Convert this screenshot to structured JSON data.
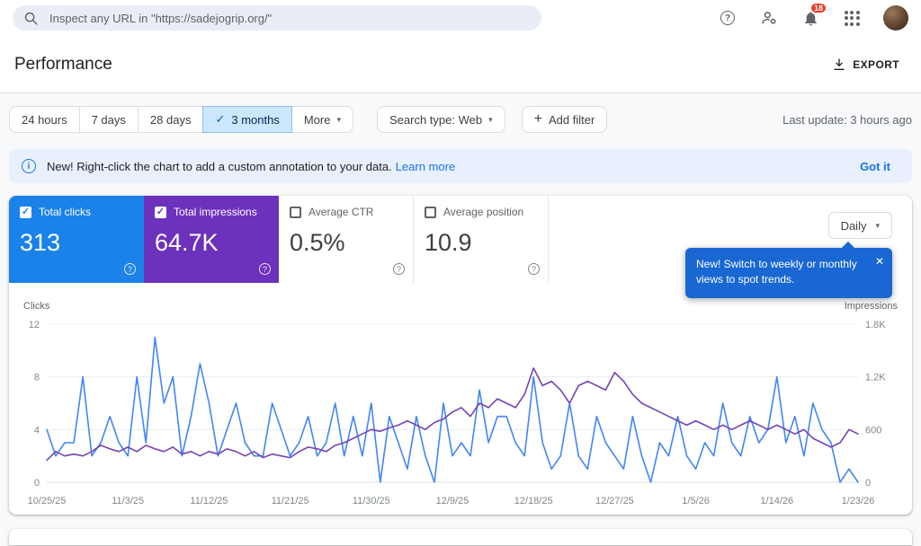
{
  "icons": {
    "check": "✓",
    "caret": "▾",
    "plus": "+",
    "close": "✕",
    "question": "?",
    "info": "i"
  },
  "topbar": {
    "search_placeholder": "Inspect any URL in \"https://sadejogrip.org/\"",
    "notification_count": "18"
  },
  "header": {
    "title": "Performance",
    "export_label": "EXPORT"
  },
  "filters": {
    "date_ranges": [
      {
        "label": "24 hours",
        "selected": false
      },
      {
        "label": "7 days",
        "selected": false
      },
      {
        "label": "28 days",
        "selected": false
      },
      {
        "label": "3 months",
        "selected": true
      },
      {
        "label": "More",
        "selected": false
      }
    ],
    "search_type_label": "Search type: Web",
    "add_filter_label": "Add filter",
    "last_update": "Last update: 3 hours ago"
  },
  "banner": {
    "text": "New! Right-click the chart to add a custom annotation to your data.",
    "link": "Learn more",
    "dismiss": "Got it"
  },
  "metrics": {
    "cards": [
      {
        "label": "Total clicks",
        "value": "313",
        "checked": true,
        "filled": true,
        "color": "#1a82e8"
      },
      {
        "label": "Total impressions",
        "value": "64.7K",
        "checked": true,
        "filled": true,
        "color": "#6d32bc"
      },
      {
        "label": "Average CTR",
        "value": "0.5%",
        "checked": false,
        "filled": false
      },
      {
        "label": "Average position",
        "value": "10.9",
        "checked": false,
        "filled": false
      }
    ],
    "granularity": "Daily"
  },
  "tooltip": {
    "text": "New! Switch to weekly or monthly views to spot trends."
  },
  "chart_data": {
    "type": "line",
    "left_axis": {
      "label": "Clicks",
      "max": 12,
      "ticks": [
        {
          "value": 0,
          "label": "0"
        },
        {
          "value": 4,
          "label": "4"
        },
        {
          "value": 8,
          "label": "8"
        },
        {
          "value": 12,
          "label": "12"
        }
      ]
    },
    "right_axis": {
      "label": "Impressions",
      "max": 1800,
      "ticks": [
        {
          "value": 0,
          "label": "0"
        },
        {
          "value": 600,
          "label": "600"
        },
        {
          "value": 1200,
          "label": "1.2K"
        },
        {
          "value": 1800,
          "label": "1.8K"
        }
      ]
    },
    "x_ticks": [
      {
        "index": 0,
        "label": "10/25/25"
      },
      {
        "index": 9,
        "label": "11/3/25"
      },
      {
        "index": 18,
        "label": "11/12/25"
      },
      {
        "index": 27,
        "label": "11/21/25"
      },
      {
        "index": 36,
        "label": "11/30/25"
      },
      {
        "index": 45,
        "label": "12/9/25"
      },
      {
        "index": 54,
        "label": "12/18/25"
      },
      {
        "index": 63,
        "label": "12/27/25"
      },
      {
        "index": 72,
        "label": "1/5/26"
      },
      {
        "index": 81,
        "label": "1/14/26"
      },
      {
        "index": 90,
        "label": "1/23/26"
      }
    ],
    "series": [
      {
        "name": "Clicks",
        "axis": "left",
        "color": "#4285f4",
        "values": [
          4,
          2,
          3,
          3,
          8,
          2,
          3,
          5,
          3,
          2,
          8,
          3,
          11,
          6,
          8,
          2,
          5,
          9,
          6,
          2,
          4,
          6,
          3,
          2,
          2,
          6,
          4,
          2,
          3,
          5,
          2,
          3,
          6,
          2,
          5,
          2,
          6,
          0,
          5,
          3,
          1,
          5,
          2,
          0,
          6,
          2,
          3,
          2,
          7,
          3,
          5,
          5,
          3,
          2,
          8,
          3,
          1,
          2,
          6,
          2,
          1,
          5,
          3,
          2,
          1,
          5,
          2,
          0,
          3,
          2,
          5,
          2,
          1,
          3,
          2,
          6,
          3,
          2,
          5,
          3,
          4,
          8,
          3,
          5,
          2,
          6,
          4,
          3,
          0,
          1,
          0
        ]
      },
      {
        "name": "Impressions",
        "axis": "right",
        "color": "#7443b6",
        "values": [
          250,
          350,
          300,
          320,
          300,
          350,
          420,
          380,
          350,
          400,
          350,
          420,
          380,
          350,
          400,
          320,
          350,
          300,
          350,
          320,
          380,
          350,
          300,
          350,
          280,
          320,
          300,
          280,
          350,
          400,
          380,
          350,
          420,
          450,
          500,
          550,
          600,
          580,
          620,
          650,
          700,
          650,
          600,
          680,
          720,
          800,
          850,
          750,
          900,
          850,
          950,
          900,
          850,
          1000,
          1300,
          1100,
          1150,
          1050,
          900,
          1100,
          1150,
          1100,
          1050,
          1250,
          1150,
          1000,
          900,
          850,
          800,
          750,
          700,
          650,
          700,
          650,
          600,
          650,
          600,
          650,
          700,
          650,
          600,
          650,
          600,
          550,
          600,
          500,
          450,
          400,
          450,
          600,
          550
        ]
      }
    ]
  }
}
